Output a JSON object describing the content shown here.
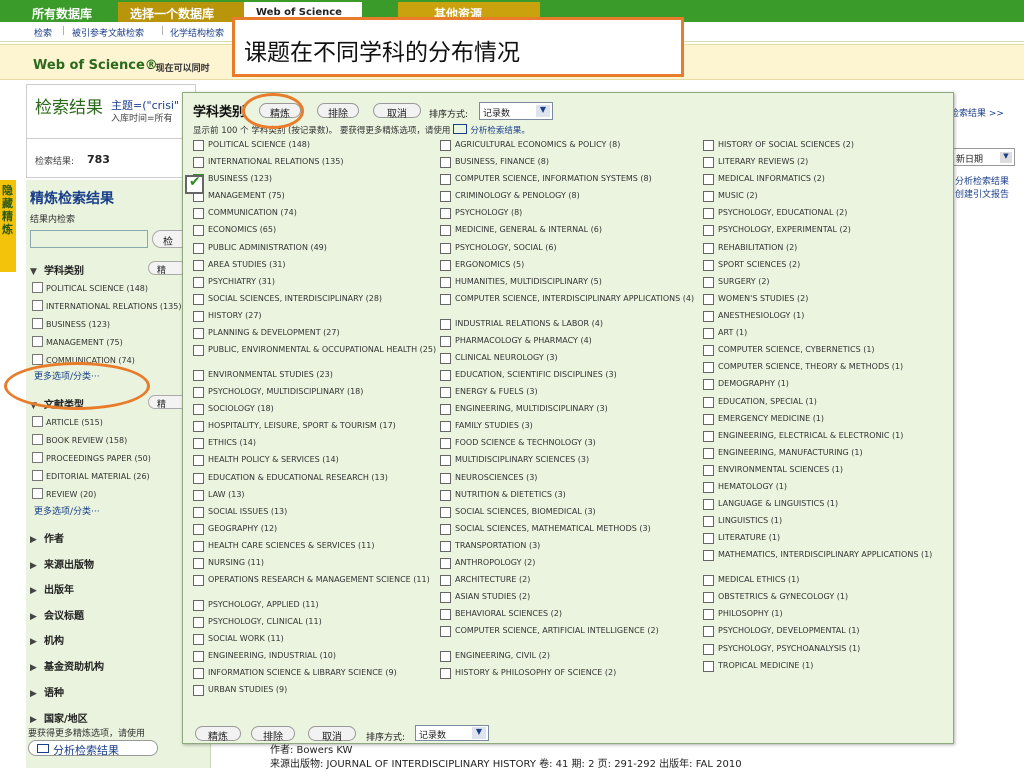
{
  "topnav": {
    "tabs": [
      "所有数据库",
      "选择一个数据库",
      "Web of Science",
      "其他资源"
    ]
  },
  "subnav": {
    "links": [
      "检索",
      "被引参考文献检索",
      "化学结构检索"
    ]
  },
  "wos": {
    "brand": "Web of Science®",
    "note": "– 现在可以同时"
  },
  "side_strip_label": "隐藏精炼",
  "callout": {
    "text": "课题在不同学科的分布情况"
  },
  "results": {
    "title": "检索结果",
    "topic": "主题=(\"crisi\"",
    "date_line": "入库时间=所有",
    "count_label": "检索结果:",
    "count": "783"
  },
  "right_side": {
    "analyze_link": "检索结果 >>",
    "sort_value": "新日期",
    "link_analyze": "分析检索结果",
    "link_citation": "创建引文报告"
  },
  "left_panel": {
    "title": "精炼检索结果",
    "search_within": "结果内检索",
    "go_label": "检",
    "pill_label": "精",
    "subject": {
      "title": "学科类别",
      "items": [
        "POLITICAL SCIENCE (148)",
        "INTERNATIONAL RELATIONS (135)",
        "BUSINESS (123)",
        "MANAGEMENT (75)",
        "COMMUNICATION (74)"
      ],
      "more": "更多选项/分类···"
    },
    "doctype": {
      "title": "文献类型",
      "items": [
        "ARTICLE (515)",
        "BOOK REVIEW (158)",
        "PROCEEDINGS PAPER (50)",
        "EDITORIAL MATERIAL (26)",
        "REVIEW (20)"
      ],
      "more": "更多选项/分类···"
    },
    "collapsed": [
      "作者",
      "来源出版物",
      "出版年",
      "会议标题",
      "机构",
      "基金资助机构",
      "语种",
      "国家/地区"
    ],
    "hint": "要获得更多精炼选项，请使用",
    "analyze_button": "分析检索结果"
  },
  "modal": {
    "title": "学科类别",
    "btn_refine": "精炼",
    "btn_exclude": "排除",
    "btn_cancel": "取消",
    "sort_label": "排序方式:",
    "sort_value": "记录数",
    "info_text": "显示前 100 个 学科类别 (按记录数)。 要获得更多精炼选项，请使用",
    "info_link": "分析检索结果。",
    "col1": [
      "POLITICAL SCIENCE (148)",
      "INTERNATIONAL RELATIONS (135)",
      "BUSINESS (123)",
      "MANAGEMENT (75)",
      "COMMUNICATION (74)",
      "ECONOMICS (65)",
      "PUBLIC ADMINISTRATION (49)",
      "AREA STUDIES (31)",
      "PSYCHIATRY (31)",
      "SOCIAL SCIENCES, INTERDISCIPLINARY (28)",
      "HISTORY (27)",
      "PLANNING & DEVELOPMENT (27)",
      "PUBLIC, ENVIRONMENTAL & OCCUPATIONAL HEALTH (25)",
      "ENVIRONMENTAL STUDIES (23)",
      "PSYCHOLOGY, MULTIDISCIPLINARY (18)",
      "SOCIOLOGY (18)",
      "HOSPITALITY, LEISURE, SPORT & TOURISM (17)",
      "ETHICS (14)",
      "HEALTH POLICY & SERVICES (14)",
      "EDUCATION & EDUCATIONAL RESEARCH (13)",
      "LAW (13)",
      "SOCIAL ISSUES (13)",
      "GEOGRAPHY (12)",
      "HEALTH CARE SCIENCES & SERVICES (11)",
      "NURSING (11)",
      "OPERATIONS RESEARCH & MANAGEMENT SCIENCE (11)",
      "PSYCHOLOGY, APPLIED (11)",
      "PSYCHOLOGY, CLINICAL (11)",
      "SOCIAL WORK (11)",
      "ENGINEERING, INDUSTRIAL (10)",
      "INFORMATION SCIENCE & LIBRARY SCIENCE (9)",
      "URBAN STUDIES (9)"
    ],
    "col2": [
      "AGRICULTURAL ECONOMICS & POLICY (8)",
      "BUSINESS, FINANCE (8)",
      "COMPUTER SCIENCE, INFORMATION SYSTEMS (8)",
      "CRIMINOLOGY & PENOLOGY (8)",
      "PSYCHOLOGY (8)",
      "MEDICINE, GENERAL & INTERNAL (6)",
      "PSYCHOLOGY, SOCIAL (6)",
      "ERGONOMICS (5)",
      "HUMANITIES, MULTIDISCIPLINARY (5)",
      "COMPUTER SCIENCE, INTERDISCIPLINARY APPLICATIONS (4)",
      "INDUSTRIAL RELATIONS & LABOR (4)",
      "PHARMACOLOGY & PHARMACY (4)",
      "CLINICAL NEUROLOGY (3)",
      "EDUCATION, SCIENTIFIC DISCIPLINES (3)",
      "ENERGY & FUELS (3)",
      "ENGINEERING, MULTIDISCIPLINARY (3)",
      "FAMILY STUDIES (3)",
      "FOOD SCIENCE & TECHNOLOGY (3)",
      "MULTIDISCIPLINARY SCIENCES (3)",
      "NEUROSCIENCES (3)",
      "NUTRITION & DIETETICS (3)",
      "SOCIAL SCIENCES, BIOMEDICAL (3)",
      "SOCIAL SCIENCES, MATHEMATICAL METHODS (3)",
      "TRANSPORTATION (3)",
      "ANTHROPOLOGY (2)",
      "ARCHITECTURE (2)",
      "ASIAN STUDIES (2)",
      "BEHAVIORAL SCIENCES (2)",
      "COMPUTER SCIENCE, ARTIFICIAL INTELLIGENCE (2)",
      "ENGINEERING, CIVIL (2)",
      "HISTORY & PHILOSOPHY OF SCIENCE (2)"
    ],
    "col3": [
      "HISTORY OF SOCIAL SCIENCES (2)",
      "LITERARY REVIEWS (2)",
      "MEDICAL INFORMATICS (2)",
      "MUSIC (2)",
      "PSYCHOLOGY, EDUCATIONAL (2)",
      "PSYCHOLOGY, EXPERIMENTAL (2)",
      "REHABILITATION (2)",
      "SPORT SCIENCES (2)",
      "SURGERY (2)",
      "WOMEN'S STUDIES (2)",
      "ANESTHESIOLOGY (1)",
      "ART (1)",
      "COMPUTER SCIENCE, CYBERNETICS (1)",
      "COMPUTER SCIENCE, THEORY & METHODS (1)",
      "DEMOGRAPHY (1)",
      "EDUCATION, SPECIAL (1)",
      "EMERGENCY MEDICINE (1)",
      "ENGINEERING, ELECTRICAL & ELECTRONIC (1)",
      "ENGINEERING, MANUFACTURING (1)",
      "ENVIRONMENTAL SCIENCES (1)",
      "HEMATOLOGY (1)",
      "LANGUAGE & LINGUISTICS (1)",
      "LINGUISTICS (1)",
      "LITERATURE (1)",
      "MATHEMATICS, INTERDISCIPLINARY APPLICATIONS (1)",
      "MEDICAL ETHICS (1)",
      "OBSTETRICS & GYNECOLOGY (1)",
      "PHILOSOPHY (1)",
      "PSYCHOLOGY, DEVELOPMENTAL (1)",
      "PSYCHOLOGY, PSYCHOANALYSIS (1)",
      "TROPICAL MEDICINE (1)"
    ],
    "checked_item": "BUSINESS (123)"
  },
  "record": {
    "author": "作者: Bowers KW",
    "source": "来源出版物: JOURNAL OF INTERDISCIPLINARY HISTORY  卷: 41  期: 2  页: 291-292  出版年: FAL 2010"
  },
  "colors": {
    "top_green": "#3a9a2a",
    "tab_gold": "#b8950a",
    "callout_orange": "#e87c2a",
    "panel_green": "#eaf4df"
  }
}
